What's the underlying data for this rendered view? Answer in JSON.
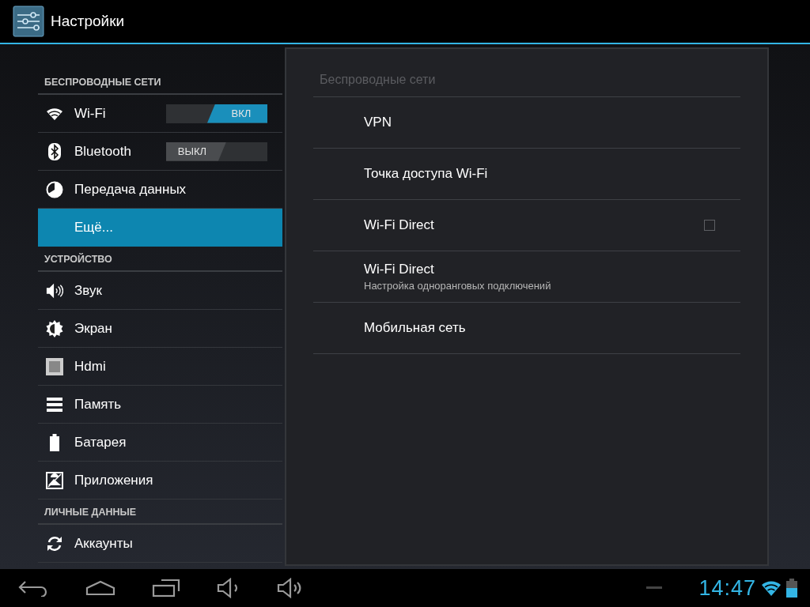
{
  "action_bar": {
    "title": "Настройки"
  },
  "sidebar": {
    "sections": [
      {
        "header": "БЕСПРОВОДНЫЕ СЕТИ",
        "items": [
          {
            "label": "Wi-Fi",
            "kind": "toggle",
            "on": true,
            "toggle_label": "ВКЛ",
            "selected": false
          },
          {
            "label": "Bluetooth",
            "kind": "toggle",
            "on": false,
            "toggle_label": "ВЫКЛ",
            "selected": false
          },
          {
            "label": "Передача данных",
            "kind": "plain",
            "selected": false
          },
          {
            "label": "Ещё...",
            "kind": "plain",
            "selected": true
          }
        ]
      },
      {
        "header": "УСТРОЙСТВО",
        "items": [
          {
            "label": "Звук",
            "kind": "plain",
            "selected": false
          },
          {
            "label": "Экран",
            "kind": "plain",
            "selected": false
          },
          {
            "label": "Hdmi",
            "kind": "plain",
            "selected": false
          },
          {
            "label": "Память",
            "kind": "plain",
            "selected": false
          },
          {
            "label": "Батарея",
            "kind": "plain",
            "selected": false
          },
          {
            "label": "Приложения",
            "kind": "plain",
            "selected": false
          }
        ]
      },
      {
        "header": "ЛИЧНЫЕ ДАННЫЕ",
        "items": [
          {
            "label": "Аккаунты",
            "kind": "plain",
            "selected": false
          }
        ]
      }
    ]
  },
  "detail": {
    "title": "Беспроводные сети",
    "items": [
      {
        "kind": "plain",
        "title": "VPN"
      },
      {
        "kind": "plain",
        "title": "Точка доступа Wi-Fi"
      },
      {
        "kind": "checkbox",
        "title": "Wi-Fi Direct",
        "checked": false
      },
      {
        "kind": "summary",
        "title": "Wi-Fi Direct",
        "summary": "Настройка одноранговых подключений"
      },
      {
        "kind": "plain",
        "title": "Мобильная сеть"
      }
    ]
  },
  "status_bar": {
    "time": "14:47"
  }
}
